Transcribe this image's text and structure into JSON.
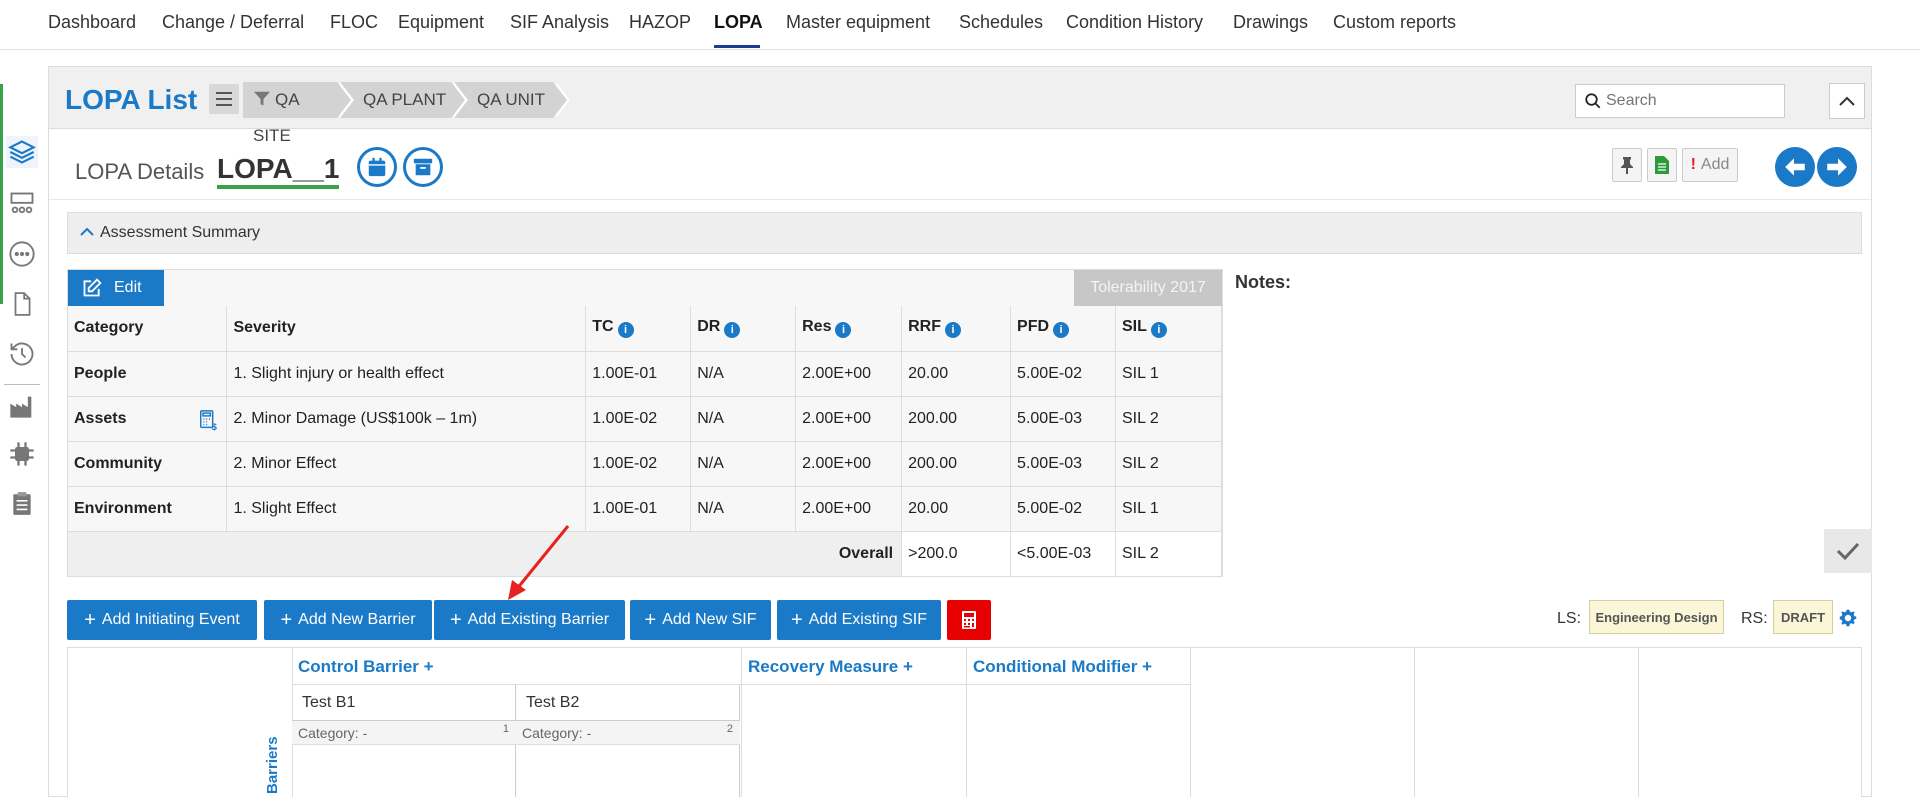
{
  "nav": {
    "items": [
      "Dashboard",
      "Change / Deferral",
      "FLOC",
      "Equipment",
      "SIF Analysis",
      "HAZOP",
      "LOPA",
      "Master equipment",
      "Schedules",
      "Condition History",
      "Drawings",
      "Custom reports"
    ],
    "active": "LOPA"
  },
  "header": {
    "title": "LOPA List",
    "breadcrumbs": [
      "QA SITE",
      "QA PLANT",
      "QA UNIT"
    ],
    "search_placeholder": "Search"
  },
  "details": {
    "label": "LOPA Details",
    "name": "LOPA__1",
    "add_label": "Add"
  },
  "accordion": {
    "label": "Assessment Summary"
  },
  "summary": {
    "edit_label": "Edit",
    "tolerability_label": "Tolerability 2017",
    "columns": [
      "Category",
      "Severity",
      "TC",
      "DR",
      "Res",
      "RRF",
      "PFD",
      "SIL"
    ],
    "rows": [
      {
        "category": "People",
        "severity": "1. Slight injury or health effect",
        "tc": "1.00E-01",
        "dr": "N/A",
        "res": "2.00E+00",
        "rrf": "20.00",
        "pfd": "5.00E-02",
        "sil": "SIL 1"
      },
      {
        "category": "Assets",
        "severity": "2. Minor Damage (US$100k – 1m)",
        "tc": "1.00E-02",
        "dr": "N/A",
        "res": "2.00E+00",
        "rrf": "200.00",
        "pfd": "5.00E-03",
        "sil": "SIL 2"
      },
      {
        "category": "Community",
        "severity": "2. Minor Effect",
        "tc": "1.00E-02",
        "dr": "N/A",
        "res": "2.00E+00",
        "rrf": "200.00",
        "pfd": "5.00E-03",
        "sil": "SIL 2"
      },
      {
        "category": "Environment",
        "severity": "1. Slight Effect",
        "tc": "1.00E-01",
        "dr": "N/A",
        "res": "2.00E+00",
        "rrf": "20.00",
        "pfd": "5.00E-02",
        "sil": "SIL 1"
      }
    ],
    "overall": {
      "label": "Overall",
      "rrf": ">200.0",
      "pfd": "<5.00E-03",
      "sil": "SIL 2"
    }
  },
  "notes_label": "Notes:",
  "actions": {
    "add_initiating_event": "Add Initiating Event",
    "add_new_barrier": "Add New Barrier",
    "add_existing_barrier": "Add Existing Barrier",
    "add_new_sif": "Add New SIF",
    "add_existing_sif": "Add Existing SIF"
  },
  "status": {
    "ls_label": "LS:",
    "ls_value": "Engineering Design",
    "rs_label": "RS:",
    "rs_value": "DRAFT"
  },
  "grid": {
    "columns": [
      "Control Barrier",
      "Recovery Measure",
      "Conditional Modifier"
    ],
    "side_label": "Barriers",
    "barriers": [
      {
        "name": "Test B1",
        "category": "Category: -",
        "index": "1"
      },
      {
        "name": "Test B2",
        "category": "Category: -",
        "index": "2"
      }
    ]
  },
  "colors": {
    "accent": "#1a7ac7",
    "active_green": "#3aa14a",
    "danger": "#e60000",
    "nav_underline": "#1a3d8f"
  }
}
